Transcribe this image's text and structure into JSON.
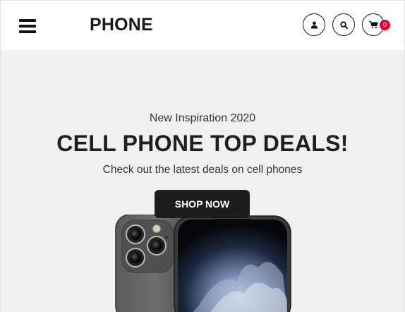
{
  "header": {
    "logo": "PHONE",
    "menu_icon": "hamburger-menu-icon",
    "user_icon": "user-icon",
    "search_icon": "search-icon",
    "cart_icon": "cart-icon",
    "cart_count": "0",
    "badge_color": "#e4002b"
  },
  "hero": {
    "eyebrow": "New Inspiration 2020",
    "title": "CELL PHONE TOP DEALS!",
    "subtitle": "Check out the latest deals on cell phones",
    "cta_label": "SHOP NOW",
    "background": "#f0f0f0",
    "button_color": "#1d1d1d"
  }
}
